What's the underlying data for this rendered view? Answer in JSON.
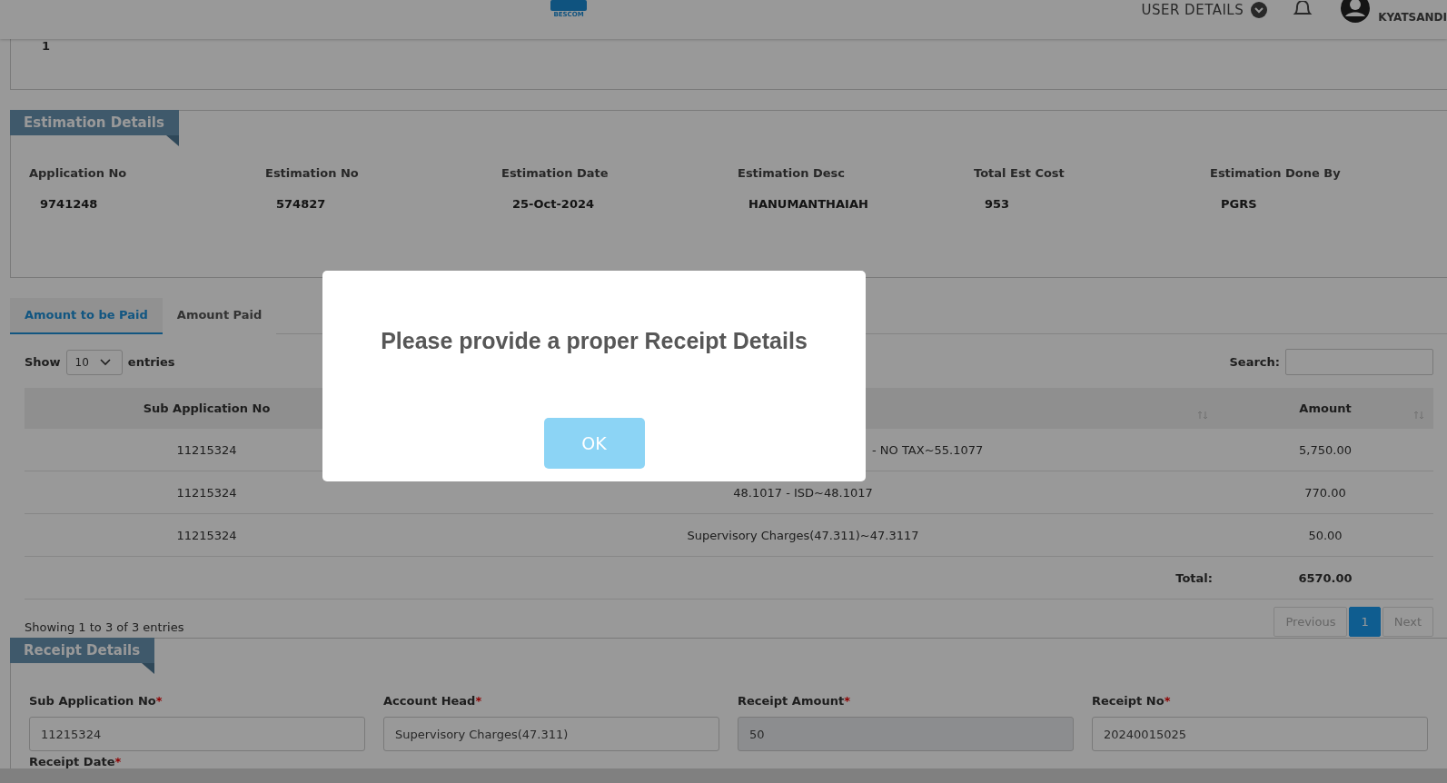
{
  "header": {
    "logo_text": "BESCOM",
    "user_details": "USER DETAILS",
    "username": "KYATSANDI"
  },
  "previous_panel": {
    "row_number": "1"
  },
  "estimation": {
    "title": "Estimation Details",
    "fields": [
      {
        "label": "Application No",
        "value": "9741248"
      },
      {
        "label": "Estimation No",
        "value": "574827"
      },
      {
        "label": "Estimation Date",
        "value": "25-Oct-2024"
      },
      {
        "label": "Estimation Desc",
        "value": "HANUMANTHAIAH"
      },
      {
        "label": "Total Est Cost",
        "value": "953"
      },
      {
        "label": "Estimation Done By",
        "value": "PGRS"
      }
    ]
  },
  "tabs": [
    {
      "label": "Amount to be Paid",
      "selected": true
    },
    {
      "label": "Amount Paid",
      "selected": false
    }
  ],
  "table_controls": {
    "show_label": "Show",
    "page_size": "10",
    "entries_label": "entries",
    "search_label": "Search:"
  },
  "table": {
    "columns": [
      {
        "label": "Sub Application No",
        "sortable": false
      },
      {
        "sortable": true
      },
      {
        "label": "Amount",
        "sortable": true
      }
    ],
    "rows": [
      {
        "kind": "partial",
        "sub_application_no": "11215324",
        "description": "- NO TAX~55.1077",
        "amount": "5,750.00"
      },
      {
        "kind": "full",
        "sub_application_no": "11215324",
        "description": "48.1017 - ISD~48.1017",
        "amount": "770.00"
      },
      {
        "kind": "full",
        "sub_application_no": "11215324",
        "description": "Supervisory Charges(47.311)~47.3117",
        "amount": "50.00"
      }
    ],
    "total": {
      "label": "Total:",
      "value": "6570.00"
    },
    "info": "Showing 1 to 3 of 3 entries",
    "pagination": [
      {
        "label": "Previous",
        "selected": false,
        "disabled": true
      },
      {
        "label": "1",
        "selected": true,
        "disabled": false
      },
      {
        "label": "Next",
        "selected": false,
        "disabled": true
      }
    ]
  },
  "receipt": {
    "title": "Receipt Details",
    "required_mark": "*",
    "fields": [
      {
        "label": "Sub Application No",
        "required": true,
        "value": "11215324",
        "readonly": false
      },
      {
        "label": "Account Head",
        "required": true,
        "value": "Supervisory Charges(47.311)",
        "readonly": false
      },
      {
        "label": "Receipt Amount",
        "required": true,
        "value": "50",
        "readonly": true
      },
      {
        "label": "Receipt No",
        "required": true,
        "value": "20240015025",
        "readonly": false
      }
    ],
    "next_field": {
      "label": "Receipt Date",
      "required": true
    }
  },
  "modal": {
    "message": "Please provide a proper Receipt Details",
    "button": "OK"
  }
}
